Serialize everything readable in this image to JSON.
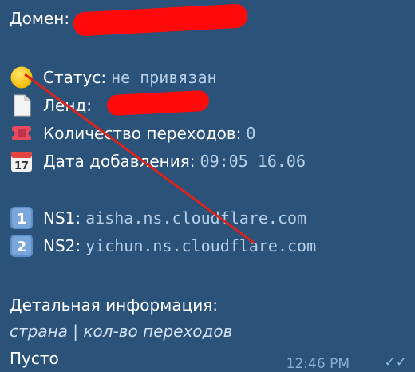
{
  "message": {
    "domain_label": "Домен:",
    "status_label": "Статус:",
    "status_value": "не привязан",
    "land_label": "Ленд:",
    "clicks_label": "Количество переходов:",
    "clicks_value": "0",
    "date_label": "Дата добавления:",
    "date_value": "09:05 16.06",
    "ns1_label": "NS1:",
    "ns1_value": "aisha.ns.cloudflare.com",
    "ns2_label": "NS2:",
    "ns2_value": "yichun.ns.cloudflare.com",
    "details_title": "Детальная информация:",
    "details_header": "страна | кол-во переходов",
    "details_value": "Пусто",
    "time": "12:46 PM"
  },
  "icons": {
    "status": "yellow-circle-icon",
    "land": "page-icon",
    "clicks": "ticket-icon",
    "date": "calendar-icon",
    "ns1": "keycap-1-icon",
    "ns2": "keycap-2-icon",
    "read": "double-check-icon"
  },
  "colors": {
    "background": "#2b5278",
    "value_text": "#b7d0ea",
    "redaction": "#ff0a0a",
    "strike_line": "#d9231d"
  }
}
